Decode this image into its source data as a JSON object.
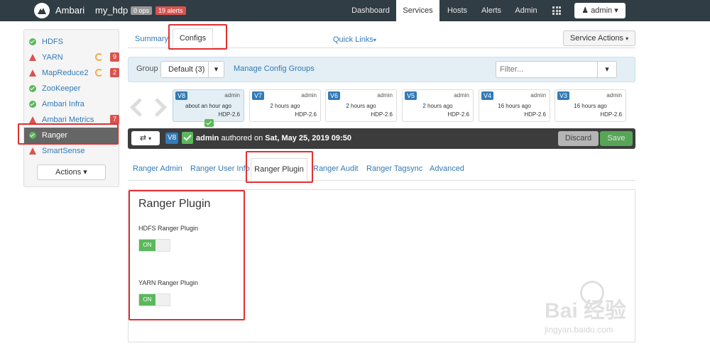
{
  "navbar": {
    "brand": "Ambari",
    "cluster": "my_hdp",
    "ops_badge": "0 ops",
    "alerts_badge": "19 alerts",
    "items": [
      "Dashboard",
      "Services",
      "Hosts",
      "Alerts",
      "Admin"
    ],
    "active_item": "Services",
    "user_menu": "admin"
  },
  "sidebar": {
    "services": [
      {
        "name": "HDFS",
        "status": "ok"
      },
      {
        "name": "YARN",
        "status": "warn",
        "alerts": "9"
      },
      {
        "name": "MapReduce2",
        "status": "warn",
        "alerts": "2"
      },
      {
        "name": "ZooKeeper",
        "status": "ok"
      },
      {
        "name": "Ambari Infra",
        "status": "ok"
      },
      {
        "name": "Ambari Metrics",
        "status": "warn",
        "alerts": "7"
      },
      {
        "name": "Ranger",
        "status": "ok",
        "active": true
      },
      {
        "name": "SmartSense",
        "status": "warn"
      }
    ],
    "actions_label": "Actions"
  },
  "tabs": {
    "summary": "Summary",
    "configs": "Configs",
    "quick_links": "Quick Links",
    "service_actions": "Service Actions"
  },
  "group_bar": {
    "label": "Group",
    "selected": "Default (3)",
    "manage_link": "Manage Config Groups",
    "filter_placeholder": "Filter..."
  },
  "versions": [
    {
      "tag": "V8",
      "author": "admin",
      "time": "about an hour ago",
      "stack": "HDP-2.6",
      "current": true
    },
    {
      "tag": "V7",
      "author": "admin",
      "time": "2 hours ago",
      "stack": "HDP-2.6"
    },
    {
      "tag": "V6",
      "author": "admin",
      "time": "2 hours ago",
      "stack": "HDP-2.6"
    },
    {
      "tag": "V5",
      "author": "admin",
      "time": "2 hours ago",
      "stack": "HDP-2.6"
    },
    {
      "tag": "V4",
      "author": "admin",
      "time": "16 hours ago",
      "stack": "HDP-2.6"
    },
    {
      "tag": "V3",
      "author": "admin",
      "time": "16 hours ago",
      "stack": "HDP-2.6"
    }
  ],
  "info_bar": {
    "version": "V8",
    "author": "admin",
    "authored_text": "authored on",
    "date": "Sat, May 25, 2019 09:50",
    "discard": "Discard",
    "save": "Save"
  },
  "subtabs": [
    "Ranger Admin",
    "Ranger User Info",
    "Ranger Plugin",
    "Ranger Audit",
    "Ranger Tagsync",
    "Advanced"
  ],
  "active_subtab": "Ranger Plugin",
  "panel": {
    "title": "Ranger Plugin",
    "plugins": [
      {
        "label": "HDFS Ranger Plugin",
        "state": "ON"
      },
      {
        "label": "YARN Ranger Plugin",
        "state": "ON"
      }
    ]
  },
  "watermark": {
    "main": "Bai 经验",
    "url": "jingyan.baidu.com"
  },
  "colors": {
    "navbar": "#313d44",
    "link": "#337ab7",
    "ok": "#5cb85c",
    "alert": "#d9534f",
    "highlight": "#e03030"
  }
}
